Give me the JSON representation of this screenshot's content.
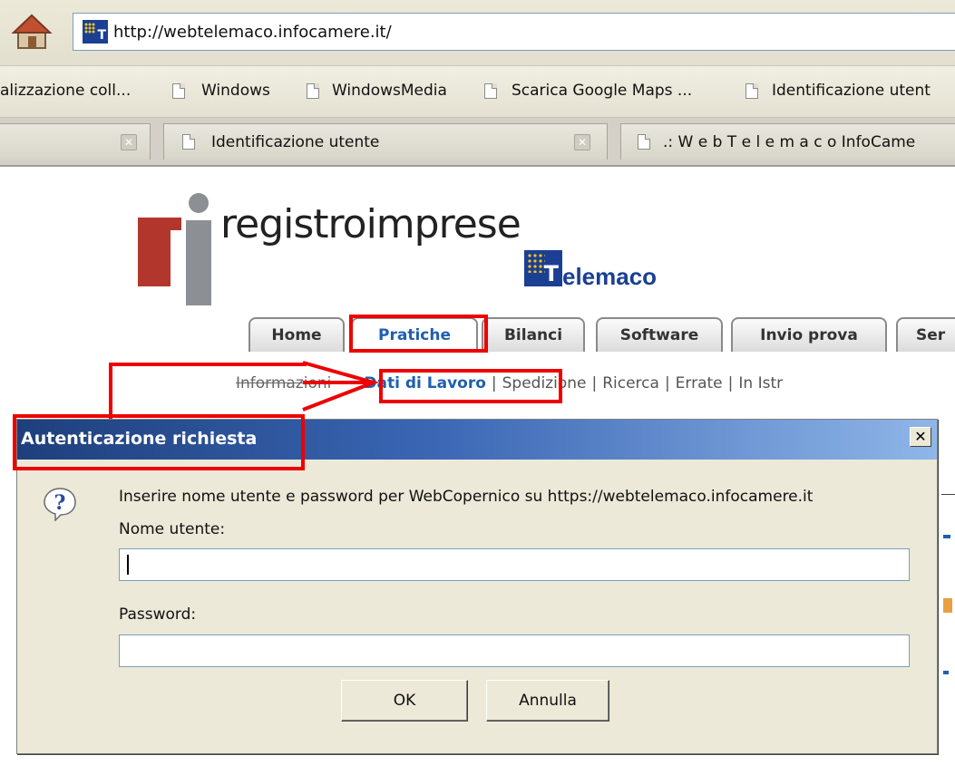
{
  "browser": {
    "url": "http://webtelemaco.infocamere.it/",
    "bookmarks": [
      "alizzazione coll...",
      "Windows",
      "WindowsMedia",
      "Scarica Google Maps ...",
      "Identificazione utent"
    ],
    "tabs": [
      {
        "label": ""
      },
      {
        "label": "Identificazione utente"
      },
      {
        "label": ".: W e b T e l e m a c o  InfoCame"
      }
    ]
  },
  "site": {
    "logo_text": "registroimprese",
    "telemaco_text": "elemaco",
    "tabs": [
      "Home",
      "Pratiche",
      "Bilanci",
      "Software",
      "Invio prova",
      "Ser"
    ],
    "active_tab": "Pratiche",
    "subnav": {
      "first": "Informazioni",
      "selected": "Dati di Lavoro",
      "items": [
        "Spedizione",
        "Ricerca",
        "Errate",
        "In Istr"
      ],
      "separator": "|"
    }
  },
  "dialog": {
    "title": "Autenticazione richiesta",
    "close_label": "x",
    "message": "Inserire nome utente e password per WebCopernico su https://webtelemaco.infocamere.it",
    "username_label": "Nome utente:",
    "username_value": "",
    "password_label": "Password:",
    "password_value": "",
    "ok_label": "OK",
    "cancel_label": "Annulla"
  },
  "colors": {
    "annotation": "#ee0000",
    "title_bar": "#1e3f7c",
    "active_tab_text": "#1f5fb0",
    "logo_red": "#b3362c",
    "logo_grey": "#8c8f93",
    "telemaco_blue": "#1b3f93"
  },
  "icons": [
    "home-icon",
    "site-favicon",
    "page-icon",
    "tab-close-icon",
    "question-icon",
    "close-icon"
  ]
}
